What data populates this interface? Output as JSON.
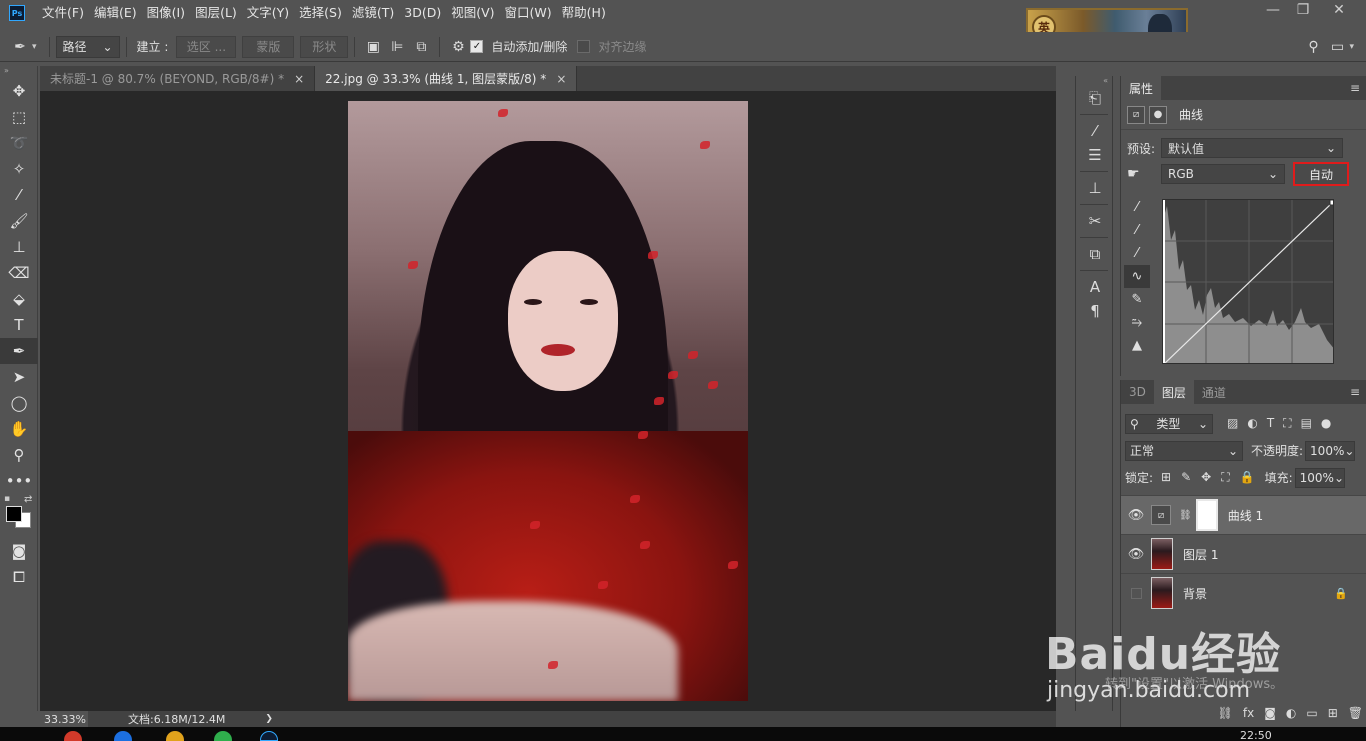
{
  "app": {
    "logo": "Ps"
  },
  "menu": [
    "文件(F)",
    "编辑(E)",
    "图像(I)",
    "图层(L)",
    "文字(Y)",
    "选择(S)",
    "滤镜(T)",
    "3D(D)",
    "视图(V)",
    "窗口(W)",
    "帮助(H)"
  ],
  "game_banner": {
    "seal_char": "英"
  },
  "window_controls": {
    "minimize": "—",
    "restore": "❐",
    "close": "✕"
  },
  "options": {
    "mode_select": "路径",
    "build_label": "建立 :",
    "selection_btn": "选区 ...",
    "mask_btn": "蒙版",
    "shape_btn": "形状",
    "auto_add_delete": "自动添加/删除",
    "align_edges": "对齐边缘"
  },
  "tabs": [
    {
      "label": "未标题-1 @ 80.7% (BEYOND, RGB/8#) *",
      "close": "×"
    },
    {
      "label": "22.jpg @ 33.3% (曲线 1, 图层蒙版/8) *",
      "close": "×"
    }
  ],
  "status": {
    "zoom": "33.33%",
    "doc": "文档:6.18M/12.4M",
    "arrow": "❯"
  },
  "properties": {
    "tab": "属性",
    "title": "曲线",
    "preset_label": "预设:",
    "preset_value": "默认值",
    "channel_value": "RGB",
    "auto_label": "自动"
  },
  "layers_panel": {
    "tabs": [
      "3D",
      "图层",
      "通道"
    ],
    "filter_value": "类型",
    "blend_mode": "正常",
    "opacity_label": "不透明度:",
    "opacity_value": "100%",
    "lock_label": "锁定:",
    "fill_label": "填充:",
    "fill_value": "100%",
    "layers": [
      {
        "name": "曲线 1",
        "visible": true,
        "selected": true
      },
      {
        "name": "图层 1",
        "visible": true,
        "selected": false
      },
      {
        "name": "背景",
        "visible": false,
        "selected": false,
        "locked": true
      }
    ],
    "footer_icons": [
      "link-icon",
      "fx-icon",
      "mask-icon",
      "adjustment-icon",
      "folder-icon",
      "new-layer-icon",
      "trash-icon"
    ]
  },
  "watermark": {
    "logo": "Baidu经验",
    "url": "jingyan.baidu.com"
  },
  "windows_notice": {
    "line1": "转到\"设置\"以激活 Windows。"
  },
  "clock": {
    "time": "22:50"
  },
  "colors": {
    "accent_red": "#e01b1b",
    "ui_bg": "#535353",
    "canvas_bg": "#282828"
  }
}
